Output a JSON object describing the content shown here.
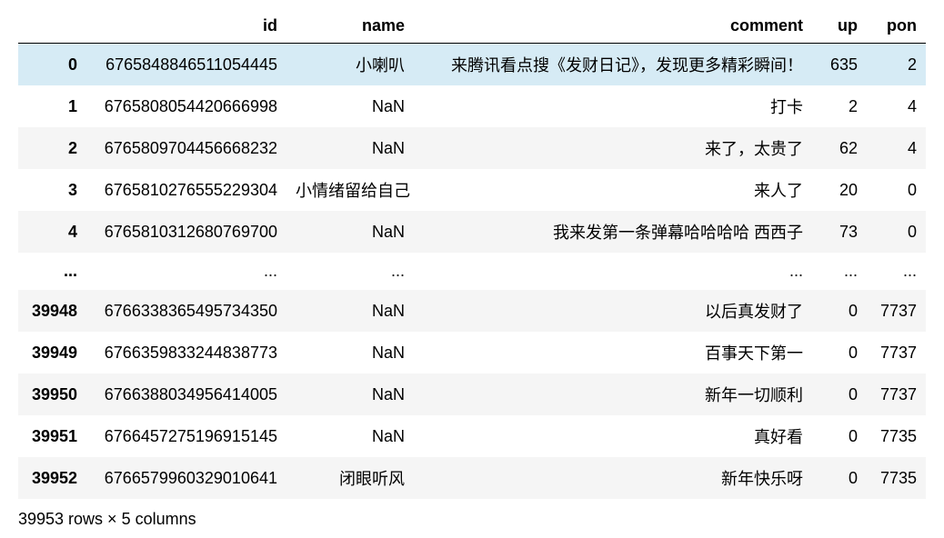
{
  "columns": {
    "index": "",
    "id": "id",
    "name": "name",
    "comment": "comment",
    "up": "up",
    "pon": "pon"
  },
  "ellipsis": "...",
  "rows_top": [
    {
      "index": "0",
      "id": "6765848846511054445",
      "name": "小喇叭",
      "comment": "来腾讯看点搜《发财日记》，发现更多精彩瞬间！",
      "up": "635",
      "pon": "2",
      "highlight": true
    },
    {
      "index": "1",
      "id": "6765808054420666998",
      "name": "NaN",
      "comment": "打卡",
      "up": "2",
      "pon": "4"
    },
    {
      "index": "2",
      "id": "6765809704456668232",
      "name": "NaN",
      "comment": "来了，太贵了",
      "up": "62",
      "pon": "4"
    },
    {
      "index": "3",
      "id": "6765810276555229304",
      "name": "小情绪留给自己",
      "comment": "来人了",
      "up": "20",
      "pon": "0"
    },
    {
      "index": "4",
      "id": "6765810312680769700",
      "name": "NaN",
      "comment": "我来发第一条弹幕哈哈哈哈 西西子",
      "up": "73",
      "pon": "0"
    }
  ],
  "rows_bottom": [
    {
      "index": "39948",
      "id": "6766338365495734350",
      "name": "NaN",
      "comment": "以后真发财了",
      "up": "0",
      "pon": "7737"
    },
    {
      "index": "39949",
      "id": "6766359833244838773",
      "name": "NaN",
      "comment": "百事天下第一",
      "up": "0",
      "pon": "7737"
    },
    {
      "index": "39950",
      "id": "6766388034956414005",
      "name": "NaN",
      "comment": "新年一切顺利",
      "up": "0",
      "pon": "7737"
    },
    {
      "index": "39951",
      "id": "6766457275196915145",
      "name": "NaN",
      "comment": "真好看",
      "up": "0",
      "pon": "7735"
    },
    {
      "index": "39952",
      "id": "6766579960329010641",
      "name": "闭眼听风",
      "comment": "新年快乐呀",
      "up": "0",
      "pon": "7735"
    }
  ],
  "footer": "39953 rows × 5 columns"
}
